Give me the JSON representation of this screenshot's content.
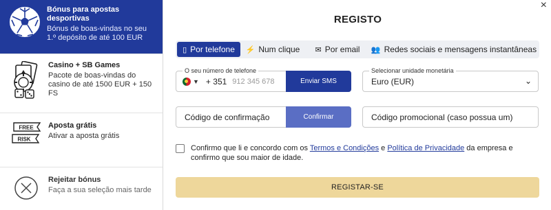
{
  "sidebar": {
    "items": [
      {
        "title": "Bónus para apostas desportivas",
        "desc": "Bónus de boas-vindas no seu 1.º depósito de até 100 EUR",
        "icon": "soccer-ball-icon"
      },
      {
        "title": "Casino + SB Games",
        "desc": "Pacote de boas-vindas do casino de até 1500 EUR + 150 FS",
        "icon": "casino-cards-dice-icon"
      },
      {
        "title": "Aposta grátis",
        "desc": "Ativar a aposta grátis",
        "icon": "free-risk-ticket-icon",
        "ticket_top": "FREE",
        "ticket_bottom": "RISK"
      },
      {
        "title": "Rejeitar bónus",
        "desc": "Faça a sua seleção mais tarde",
        "icon": "close-circle-icon"
      }
    ]
  },
  "form": {
    "title": "REGISTO",
    "close": "×",
    "tabs": [
      {
        "label": "Por telefone",
        "icon": "phone-icon",
        "glyph": "▯",
        "active": true
      },
      {
        "label": "Num clique",
        "icon": "lightning-icon",
        "glyph": "⚡",
        "active": false
      },
      {
        "label": "Por email",
        "icon": "envelope-icon",
        "glyph": "✉",
        "active": false
      },
      {
        "label": "Redes sociais e mensagens instantâneas",
        "icon": "users-icon",
        "glyph": "👥",
        "active": false
      }
    ],
    "phone": {
      "label": "O seu número de telefone",
      "country_code": "+ 351",
      "placeholder": "912 345 678",
      "send_sms": "Enviar SMS"
    },
    "currency": {
      "label": "Selecionar unidade monetária",
      "value": "Euro (EUR)"
    },
    "confirmation": {
      "placeholder": "Código de confirmação",
      "button": "Confirmar"
    },
    "promo": {
      "placeholder": "Código promocional (caso possua um)"
    },
    "terms": {
      "part1": "Confirmo que li e concordo com os ",
      "link1": "Termos e Condições",
      "part2": " e ",
      "link2": "Política de Privacidade",
      "part3": " da empresa e confirmo que sou maior de idade."
    },
    "submit": "REGISTAR-SE"
  },
  "colors": {
    "primary": "#213a9b",
    "confirm": "#5a6ec4",
    "submit": "#eed79b"
  }
}
